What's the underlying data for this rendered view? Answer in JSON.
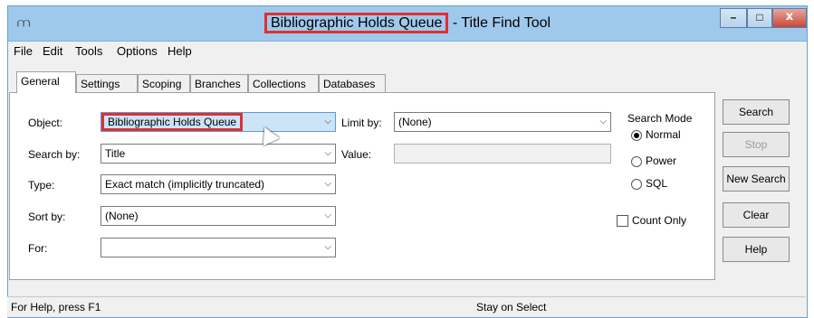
{
  "window": {
    "title_highlight": "Bibliographic Holds Queue",
    "title_rest": "- Title Find Tool",
    "minimize": "–",
    "maximize": "□",
    "close": "x"
  },
  "menu": [
    "File",
    "Edit",
    "Tools",
    "Options",
    "Help"
  ],
  "tabs": [
    "General",
    "Settings",
    "Scoping",
    "Branches",
    "Collections",
    "Databases"
  ],
  "form": {
    "object_label": "Object:",
    "object_value": "Bibliographic Holds Queue",
    "limit_label": "Limit by:",
    "limit_value": "(None)",
    "search_by_label": "Search by:",
    "search_by_value": "Title",
    "value_label": "Value:",
    "type_label": "Type:",
    "type_value": "Exact match (implicitly truncated)",
    "sort_label": "Sort by:",
    "sort_value": "(None)",
    "for_label": "For:",
    "for_value": ""
  },
  "search_mode": {
    "title": "Search Mode",
    "options": [
      "Normal",
      "Power",
      "SQL"
    ],
    "selected": "Normal"
  },
  "count_only": "Count Only",
  "buttons": {
    "search": "Search",
    "stop": "Stop",
    "new_search": "New Search",
    "clear": "Clear",
    "help": "Help"
  },
  "status": {
    "left": "For Help, press F1",
    "mid": "Stay on Select"
  }
}
